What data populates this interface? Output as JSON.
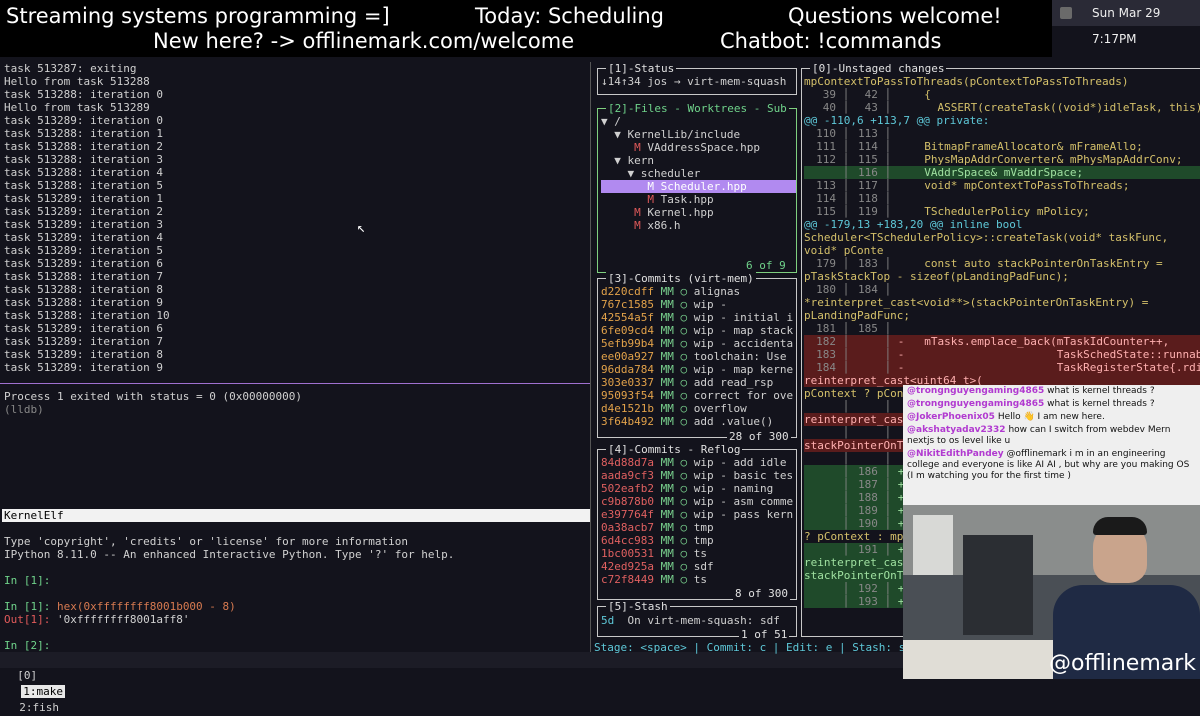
{
  "banner": {
    "title": "Streaming systems programming =]",
    "topic": "Today: Scheduling",
    "questions": "Questions welcome!",
    "welcome": "New here? -> offlinemark.com/welcome",
    "chatbot": "Chatbot: !commands"
  },
  "menubar": {
    "datetime": "Sun Mar 29  7:17PM"
  },
  "left_terminal": {
    "lines": [
      "task 513287: exiting",
      "Hello from task 513288",
      "task 513288: iteration 0",
      "Hello from task 513289",
      "task 513289: iteration 0",
      "task 513288: iteration 1",
      "task 513288: iteration 2",
      "task 513288: iteration 3",
      "task 513288: iteration 4",
      "task 513288: iteration 5",
      "task 513289: iteration 1",
      "task 513289: iteration 2",
      "task 513289: iteration 3",
      "task 513289: iteration 4",
      "task 513289: iteration 5",
      "task 513289: iteration 6",
      "task 513288: iteration 7",
      "task 513288: iteration 8",
      "task 513288: iteration 9",
      "task 513288: iteration 10",
      "task 513289: iteration 6",
      "task 513289: iteration 7",
      "task 513289: iteration 8",
      "task 513289: iteration 9"
    ],
    "lldb_lines": [
      "Process 1 exited with status = 0 (0x00000000)",
      "(lldb)"
    ],
    "status_label": "KernelElf",
    "ipython_lines": [
      "Type 'copyright', 'credits' or 'license' for more information",
      "IPython 8.11.0 -- An enhanced Interactive Python. Type '?' for help."
    ],
    "in1": "In [1]:",
    "in1_cmd_prefix": "In [1]: ",
    "in1_cmd": "hex(0xffffffff8001b000 - 8)",
    "out1_prefix": "Out[1]: ",
    "out1": "'0xffffffff8001aff8'",
    "in2": "In [2]:"
  },
  "tmux": {
    "tab0": "[0]",
    "tab1": "1:make",
    "tab2": "2:fish"
  },
  "status_panel": {
    "title": "[1]-Status",
    "content": "↓14↑34 jos → virt-mem-squash"
  },
  "files_panel": {
    "title": "[2]-Files - Worktrees - Sub",
    "items": [
      {
        "indent": "",
        "mark": "",
        "text": "▼ /"
      },
      {
        "indent": "  ",
        "mark": "",
        "text": "▼ KernelLib/include"
      },
      {
        "indent": "     ",
        "mark": "M",
        "text": "VAddressSpace.hpp"
      },
      {
        "indent": "  ",
        "mark": "",
        "text": "▼ kern"
      },
      {
        "indent": "    ",
        "mark": "",
        "text": "▼ scheduler"
      },
      {
        "indent": "       ",
        "mark": "M",
        "text": "Scheduler.hpp",
        "selected": true
      },
      {
        "indent": "       ",
        "mark": "M",
        "text": "Task.hpp"
      },
      {
        "indent": "     ",
        "mark": "M",
        "text": "Kernel.hpp"
      },
      {
        "indent": "     ",
        "mark": "M",
        "text": "x86.h"
      }
    ],
    "counter": "6 of 9"
  },
  "commits_panel": {
    "title": "[3]-Commits (virt-mem)",
    "items": [
      {
        "sha": "d220cdff",
        "msg": "alignas"
      },
      {
        "sha": "767c1585",
        "msg": "wip -"
      },
      {
        "sha": "42554a5f",
        "msg": "wip - initial i"
      },
      {
        "sha": "6fe09cd4",
        "msg": "wip - map stack"
      },
      {
        "sha": "5efb99b4",
        "msg": "wip - accidenta"
      },
      {
        "sha": "ee00a927",
        "msg": "toolchain: Use"
      },
      {
        "sha": "96dda784",
        "msg": "wip - map kerne"
      },
      {
        "sha": "303e0337",
        "msg": "add read_rsp"
      },
      {
        "sha": "95093f54",
        "msg": "correct for ove"
      },
      {
        "sha": "d4e1521b",
        "msg": "overflow"
      },
      {
        "sha": "3f64b492",
        "msg": "add .value()"
      }
    ],
    "counter": "28 of 300"
  },
  "reflog_panel": {
    "title": "[4]-Commits - Reflog",
    "items": [
      {
        "sha": "84d88d7a",
        "msg": "wip - add idle"
      },
      {
        "sha": "aada9cf3",
        "msg": "wip - basic tes"
      },
      {
        "sha": "502eafb2",
        "msg": "wip - naming"
      },
      {
        "sha": "c9b878b0",
        "msg": "wip - asm comme"
      },
      {
        "sha": "e397764f",
        "msg": "wip - pass kern"
      },
      {
        "sha": "0a38acb7",
        "msg": "tmp"
      },
      {
        "sha": "6d4cc983",
        "msg": "tmp"
      },
      {
        "sha": "1bc00531",
        "msg": "ts"
      },
      {
        "sha": "42ed925a",
        "msg": "sdf"
      },
      {
        "sha": "c72f8449",
        "msg": "ts"
      }
    ],
    "counter": "8 of 300"
  },
  "stash_panel": {
    "title": "[5]-Stash",
    "entry_id": "5d",
    "entry_msg": "On virt-mem-squash: sdf",
    "counter": "1 of 51"
  },
  "commit_flag": "MM",
  "bottom_help": "Stage: <space> | Commit: c | Edit: e | Stash: s",
  "diff_panel": {
    "title": "[0]-Unstaged changes",
    "lines": [
      {
        "kind": "code",
        "text": "mpContextToPassToThreads(pContextToPassToThreads)"
      },
      {
        "kind": "ctx",
        "a": "39",
        "b": "42",
        "text": "    {"
      },
      {
        "kind": "ctx",
        "a": "40",
        "b": "43",
        "text": "      ASSERT(createTask((void*)idleTask, this));"
      },
      {
        "kind": "hunk",
        "text": "@@ -110,6 +113,7 @@ private:"
      },
      {
        "kind": "ctx",
        "a": "110",
        "b": "113",
        "text": ""
      },
      {
        "kind": "ctx",
        "a": "111",
        "b": "114",
        "text": "    BitmapFrameAllocator& mFrameAllo;"
      },
      {
        "kind": "ctx",
        "a": "112",
        "b": "115",
        "text": "    PhysMapAddrConverter& mPhysMapAddrConv;"
      },
      {
        "kind": "add",
        "a": "",
        "b": "116",
        "text": "    VAddrSpace& mVaddrSpace;"
      },
      {
        "kind": "ctx",
        "a": "113",
        "b": "117",
        "text": "    void* mpContextToPassToThreads;"
      },
      {
        "kind": "ctx",
        "a": "114",
        "b": "118",
        "text": ""
      },
      {
        "kind": "ctx",
        "a": "115",
        "b": "119",
        "text": "    TSchedulerPolicy mPolicy;"
      },
      {
        "kind": "hunk",
        "text": "@@ -179,13 +183,20 @@ inline bool"
      },
      {
        "kind": "code",
        "text": "Scheduler<TSchedulerPolicy>::createTask(void* taskFunc,"
      },
      {
        "kind": "code",
        "text": "void* pConte"
      },
      {
        "kind": "ctx",
        "a": "179",
        "b": "183",
        "text": "    const auto stackPointerOnTaskEntry ="
      },
      {
        "kind": "code",
        "text": "pTaskStackTop - sizeof(pLandingPadFunc);"
      },
      {
        "kind": "ctx",
        "a": "180",
        "b": "184",
        "text": ""
      },
      {
        "kind": "code",
        "text": "*reinterpret_cast<void**>(stackPointerOnTaskEntry) ="
      },
      {
        "kind": "code",
        "text": "pLandingPadFunc;"
      },
      {
        "kind": "ctx",
        "a": "181",
        "b": "185",
        "text": ""
      },
      {
        "kind": "del",
        "a": "182",
        "b": "",
        "text": "-   mTasks.emplace_back(mTaskIdCounter++,"
      },
      {
        "kind": "del",
        "a": "183",
        "b": "",
        "text": "-                       TaskSchedState::runnable,"
      },
      {
        "kind": "del",
        "a": "184",
        "b": "",
        "text": "-                       TaskRegisterState{.rdi ="
      },
      {
        "kind": "delcode",
        "text": "reinterpret_cast<uint64_t>("
      },
      {
        "kind": "code",
        "text": "pContext ? pCon"
      },
      {
        "kind": "ctx",
        "a": "",
        "b": "",
        "text": ""
      },
      {
        "kind": "delcode",
        "text": "reinterpret_cas"
      },
      {
        "kind": "ctx",
        "a": "",
        "b": "",
        "text": ""
      },
      {
        "kind": "delcode",
        "text": "stackPointerOnT"
      },
      {
        "kind": "ctx",
        "a": "",
        "b": "",
        "text": ""
      },
      {
        "kind": "add",
        "a": "",
        "b": "186",
        "text": "+"
      },
      {
        "kind": "add",
        "a": "",
        "b": "187",
        "text": "+"
      },
      {
        "kind": "add",
        "a": "",
        "b": "188",
        "text": "+"
      },
      {
        "kind": "add",
        "a": "",
        "b": "189",
        "text": "+"
      },
      {
        "kind": "add",
        "a": "",
        "b": "190",
        "text": "+"
      },
      {
        "kind": "code",
        "text": "? pContext : mp"
      },
      {
        "kind": "add",
        "a": "",
        "b": "191",
        "text": "+"
      },
      {
        "kind": "addcode",
        "text": "reinterpret_cas"
      },
      {
        "kind": "addcode",
        "text": "stackPointerOnT"
      },
      {
        "kind": "add",
        "a": "",
        "b": "192",
        "text": "+"
      },
      {
        "kind": "add",
        "a": "",
        "b": "193",
        "text": "+"
      }
    ]
  },
  "chat": {
    "messages": [
      {
        "user": "@trongnguyengaming4865",
        "text": "what is kernel threads ?"
      },
      {
        "user": "@trongnguyengaming4865",
        "text": "what is kernel threads ?"
      },
      {
        "user": "@JokerPhoenix05",
        "text": "Hello 👋 I am new here."
      },
      {
        "user": "@akshatyadav2332",
        "text": "how can I switch from webdev Mern nextjs to os level like u"
      },
      {
        "user": "@NikitEdithPandey",
        "text": "@offlinemark i m in an engineering college and everyone is like AI AI , but why are you making OS (I m watching you for the first time )"
      }
    ]
  },
  "webcam": {
    "handle": "@offlinemark"
  }
}
